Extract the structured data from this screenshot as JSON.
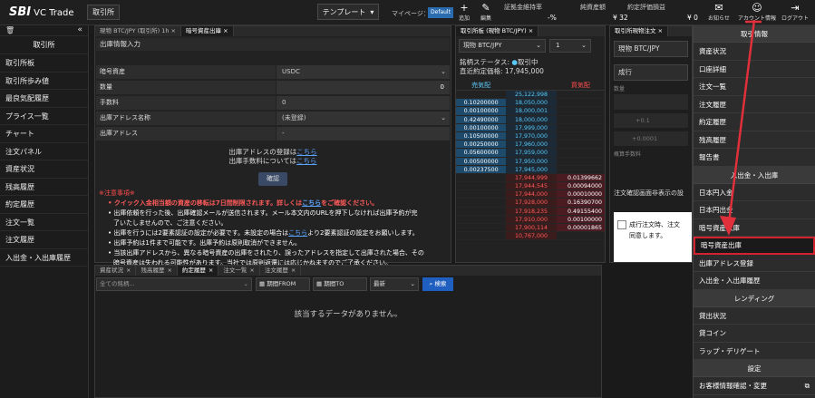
{
  "header": {
    "logo": "SBI",
    "logo_sub": "VC Trade",
    "mode_button": "取引所",
    "template_label": "テンプレート",
    "mypage_label": "マイページ：",
    "mypage_value": "Default",
    "add_label": "追加",
    "edit_label": "編集",
    "margin_rate_label": "証拠金維持率",
    "margin_rate_value": "-%",
    "net_assets_label": "純資産額",
    "net_assets_value": "¥ 32",
    "unrealized_label": "約定評価損益",
    "unrealized_value": "¥ 0",
    "notices_label": "お知らせ",
    "account_label": "アカウント情報",
    "logout_label": "ログアウト"
  },
  "sidebar": {
    "title": "取引所",
    "items": [
      "取引所板",
      "取引所歩み値",
      "最良気配履歴",
      "プライス一覧",
      "チャート",
      "注文パネル",
      "資産状況",
      "残高履歴",
      "約定履歴",
      "注文一覧",
      "注文履歴",
      "入出金・入出庫履歴"
    ]
  },
  "withdraw_panel": {
    "tabs": [
      "現物 BTC/JPY (取引所) 1h",
      "暗号資産出庫"
    ],
    "section_title": "出庫情報入力",
    "fields": [
      {
        "label": "暗号資産",
        "value": "USDC"
      },
      {
        "label": "数量",
        "value": "0"
      },
      {
        "label": "手数料",
        "value": "0"
      },
      {
        "label": "出庫アドレス名称",
        "value": "(未登録)"
      },
      {
        "label": "出庫アドレス",
        "value": "-"
      }
    ],
    "reg_text": "出庫アドレスの登録は",
    "fee_text": "出庫手数料については",
    "here": "こちら",
    "confirm_button": "確認",
    "notice_title": "※注意事項※",
    "notices": [
      "クイック入金相当額の資産の移転は7日間制限されます。詳しくは",
      "こちら",
      "をご確認ください。",
      "出庫依頼を行った後、出庫確認メールが送信されます。メール本文内のURLを押下しなければ出庫予約が完",
      "了いたしませんので、ご注意ください。",
      "出庫を行うには2要素認証の設定が必要です。未設定の場合は",
      "より2要素認証の設定をお願いします。",
      "出庫予約は1件まで可能です。出庫予約は原則取消ができません。",
      "当該出庫アドレスから、異なる暗号資産の出庫をされたり、誤ったアドレスを指定して出庫された場合、その",
      "暗号資産は失われる可能性があります。当社では原則返還には応じかねますのでご了承ください。"
    ]
  },
  "orderbook": {
    "tab": "取引所板 (現物 BTC/JPY)",
    "pair": "現物 BTC/JPY",
    "qty": "1",
    "status_label": "銘柄ステータス:",
    "status_value": "取引中",
    "last_label": "直近約定価格:",
    "last_value": "17,945,000",
    "sell_label": "売気配",
    "buy_label": "買気配",
    "rows": [
      {
        "ask": "",
        "price": "25,122,998",
        "bid": ""
      },
      {
        "ask": "0.10200000",
        "price": "18,050,000",
        "bid": ""
      },
      {
        "ask": "0.00100000",
        "price": "18,000,001",
        "bid": ""
      },
      {
        "ask": "0.42490000",
        "price": "18,000,000",
        "bid": ""
      },
      {
        "ask": "0.00100000",
        "price": "17,999,000",
        "bid": ""
      },
      {
        "ask": "0.10500000",
        "price": "17,970,000",
        "bid": ""
      },
      {
        "ask": "0.00250000",
        "price": "17,960,000",
        "bid": ""
      },
      {
        "ask": "0.05600000",
        "price": "17,959,000",
        "bid": ""
      },
      {
        "ask": "0.00500000",
        "price": "17,950,000",
        "bid": ""
      },
      {
        "ask": "0.00237500",
        "price": "17,945,000",
        "bid": ""
      },
      {
        "ask": "",
        "price": "17,944,999",
        "bid": "0.01399662"
      },
      {
        "ask": "",
        "price": "17,944,545",
        "bid": "0.00094000"
      },
      {
        "ask": "",
        "price": "17,944,000",
        "bid": "0.00010000"
      },
      {
        "ask": "",
        "price": "17,928,000",
        "bid": "0.16390700"
      },
      {
        "ask": "",
        "price": "17,918,235",
        "bid": "0.49155400"
      },
      {
        "ask": "",
        "price": "17,910,000",
        "bid": "0.00100000"
      },
      {
        "ask": "",
        "price": "17,900,114",
        "bid": "0.00001865"
      },
      {
        "ask": "",
        "price": "10,767,000",
        "bid": ""
      }
    ]
  },
  "order_panel": {
    "tab": "取引所現物注文",
    "pair": "現物 BTC/JPY",
    "type": "成行",
    "qty_label": "数量",
    "plus1": "+0.1",
    "plus0001": "+0.0001",
    "fee_label": "概算手数料",
    "confirm_title": "注文確認画面非表示の設",
    "confirm_text": "成行注文時、注文",
    "agree_text": "同意します。"
  },
  "bottom_panel": {
    "tabs": [
      "資産状況",
      "残高履歴",
      "約定履歴",
      "注文一覧",
      "注文履歴"
    ],
    "pair_placeholder": "全ての銘柄...",
    "from_label": "期間FROM",
    "to_label": "期間TO",
    "sort": "最新",
    "search": "検索",
    "empty": "該当するデータがありません。"
  },
  "account_menu": {
    "sections": [
      {
        "title": "取引情報",
        "items": [
          "資産状況",
          "口座詳細",
          "注文一覧",
          "注文履歴",
          "約定履歴",
          "残高履歴",
          "報告書"
        ]
      },
      {
        "title": "入出金・入出庫",
        "items": [
          "日本円入金",
          "日本円出金",
          "暗号資産入庫",
          "暗号資産出庫",
          "出庫アドレス登録",
          "入出金・入出庫履歴"
        ]
      },
      {
        "title": "レンディング",
        "items": [
          "貸出状況",
          "貸コイン",
          "ラップ・デリゲート"
        ]
      },
      {
        "title": "設定",
        "items": [
          "お客様情報確認・変更"
        ]
      }
    ]
  }
}
